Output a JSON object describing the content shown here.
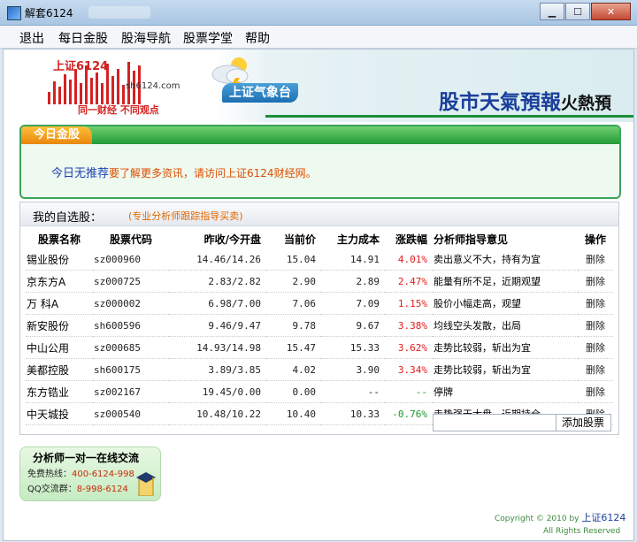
{
  "window": {
    "title": "解套6124",
    "icon": "app-icon",
    "controls": {
      "minimize": "▁",
      "maximize": "☐",
      "close": "✕"
    }
  },
  "menu": [
    "退出",
    "每日金股",
    "股海导航",
    "股票学堂",
    "帮助"
  ],
  "header": {
    "logo_top": "上证6124",
    "logo_domain": "sh6124.com",
    "logo_slogan": "同一财经  不同观点",
    "weather_label": "上证气象台",
    "headline": "股市天氣預報",
    "headline_hot": "火熱預"
  },
  "today": {
    "tab": "今日金股",
    "msg_blue": "今日无推荐",
    "msg_orange": "要了解更多资讯，请访问",
    "msg_link": "上证6124财经网",
    "msg_end": "。"
  },
  "watchlist": {
    "title": "我的自选股：",
    "subtitle": "(专业分析师跟踪指导买卖)",
    "columns": [
      "股票名称",
      "股票代码",
      "昨收/今开盘",
      "当前价",
      "主力成本",
      "涨跌幅",
      "分析师指导意见",
      "操作"
    ],
    "rows": [
      {
        "name": "锡业股份",
        "code": "sz000960",
        "prev_open": "14.46/14.26",
        "price": "15.04",
        "cost": "14.91",
        "change": "4.01%",
        "advice": "卖出意义不大，持有为宜",
        "action": "删除"
      },
      {
        "name": "京东方A",
        "code": "sz000725",
        "prev_open": "2.83/2.82",
        "price": "2.90",
        "cost": "2.89",
        "change": "2.47%",
        "advice": "能量有所不足，近期观望",
        "action": "删除"
      },
      {
        "name": "万 科A",
        "code": "sz000002",
        "prev_open": "6.98/7.00",
        "price": "7.06",
        "cost": "7.09",
        "change": "1.15%",
        "advice": "股价小幅走高，观望",
        "action": "删除"
      },
      {
        "name": "新安股份",
        "code": "sh600596",
        "prev_open": "9.46/9.47",
        "price": "9.78",
        "cost": "9.67",
        "change": "3.38%",
        "advice": "均线空头发散，出局",
        "action": "删除"
      },
      {
        "name": "中山公用",
        "code": "sz000685",
        "prev_open": "14.93/14.98",
        "price": "15.47",
        "cost": "15.33",
        "change": "3.62%",
        "advice": "走势比较弱，斩出为宜",
        "action": "删除"
      },
      {
        "name": "美都控股",
        "code": "sh600175",
        "prev_open": "3.89/3.85",
        "price": "4.02",
        "cost": "3.90",
        "change": "3.34%",
        "advice": "走势比较弱，斩出为宜",
        "action": "删除"
      },
      {
        "name": "东方锆业",
        "code": "sz002167",
        "prev_open": "19.45/0.00",
        "price": "0.00",
        "cost": "--",
        "change": "--",
        "advice": "停牌",
        "action": "删除"
      },
      {
        "name": "中天城投",
        "code": "sz000540",
        "prev_open": "10.48/10.22",
        "price": "10.40",
        "cost": "10.33",
        "change": "-0.76%",
        "advice": "走势强于大盘，近期持仓",
        "action": "删除"
      }
    ],
    "add_input": "",
    "add_button": "添加股票",
    "up_color": "#e21b1b",
    "down_color": "#1a9a2c"
  },
  "analyst": {
    "title": "分析师一对一在线交流",
    "hotline_label": "免费热线：",
    "hotline": "400-6124-998",
    "qq_label": "QQ交流群：",
    "qq": "8-998-6124"
  },
  "footer": {
    "copyright": "Copyright © 2010 by",
    "brand": "上证6124",
    "rights": "All Rights Reserved"
  }
}
